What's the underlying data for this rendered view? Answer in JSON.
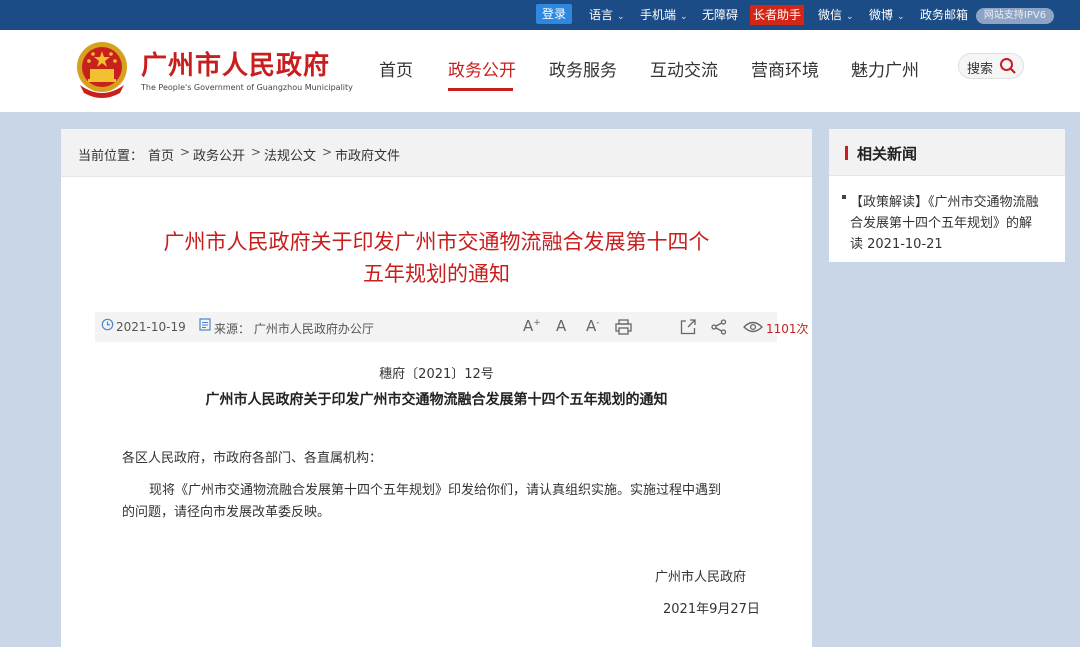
{
  "topbar": {
    "login": "登录",
    "language": "语言",
    "mobile": "手机端",
    "accessibility": "无障碍",
    "elder": "长者助手",
    "wechat": "微信",
    "weibo": "微博",
    "mail": "政务邮箱",
    "ipv6": "网站支持IPV6"
  },
  "header": {
    "title": "广州市人民政府",
    "subtitle": "The People's Government of Guangzhou Municipality",
    "nav": [
      "首页",
      "政务公开",
      "政务服务",
      "互动交流",
      "营商环境",
      "魅力广州"
    ],
    "active_nav": "政务公开",
    "search": "搜索"
  },
  "breadcrumb": {
    "label": "当前位置：",
    "items": [
      "首页",
      "政务公开",
      "法规公文",
      "市政府文件"
    ]
  },
  "article": {
    "title_line1": "广州市人民政府关于印发广州市交通物流融合发展第十四个",
    "title_line2": "五年规划的通知",
    "date": "2021-10-19",
    "source": "来源：  广州市人民政府办公厅",
    "tools": [
      "A+",
      "A",
      "A-",
      "print",
      "share",
      "share-link"
    ],
    "views": "1101次",
    "doc_number": "穗府〔2021〕12号",
    "subtitle": "广州市人民政府关于印发广州市交通物流融合发展第十四个五年规划的通知",
    "salutation": "各区人民政府，市政府各部门、各直属机构：",
    "para_line1": "现将《广州市交通物流融合发展第十四个五年规划》印发给你们，请认真组织实施。实施过程中遇到",
    "para_line2": "的问题，请径向市发展改革委反映。",
    "signature": "广州市人民政府",
    "sign_date": "2021年9月27日"
  },
  "related": {
    "title": "相关新闻",
    "items": [
      {
        "line1": "【政策解读】《广州市交通物流融",
        "line2": "合发展第十四个五年规划》的解",
        "line3": "读    2021-10-21"
      }
    ]
  },
  "colors": {
    "topbar": "#1c4c86",
    "accent_red": "#c81e1e",
    "page_bg": "#c9d6e8"
  }
}
